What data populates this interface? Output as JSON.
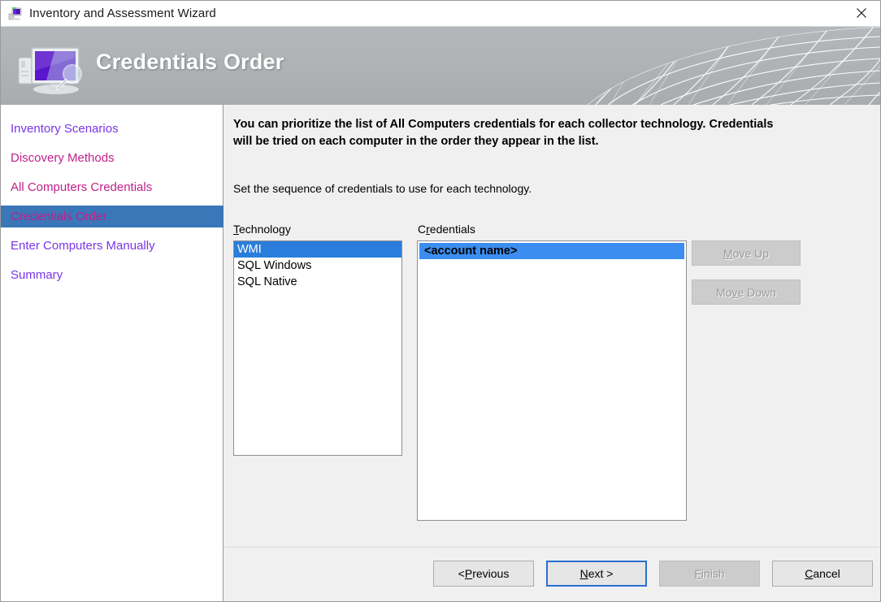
{
  "window": {
    "title": "Inventory and Assessment Wizard",
    "title_icon": "wizard-computer-icon",
    "close_icon": "close-icon"
  },
  "banner": {
    "title": "Credentials Order",
    "icon": "computer-magnifier-icon",
    "background_color": "#b0b3b6",
    "title_color": "#ffffff"
  },
  "sidebar": {
    "items": [
      {
        "label": "Inventory Scenarios",
        "state": "unvisited"
      },
      {
        "label": "Discovery Methods",
        "state": "visited"
      },
      {
        "label": "All Computers Credentials",
        "state": "visited"
      },
      {
        "label": "Credentials Order",
        "state": "current"
      },
      {
        "label": "Enter Computers Manually",
        "state": "unvisited"
      },
      {
        "label": "Summary",
        "state": "unvisited"
      }
    ],
    "current_highlight_color": "#3a76b8",
    "visited_color": "#c0208a",
    "unvisited_color": "#7a35e8"
  },
  "main": {
    "intro_bold": "You can prioritize the list of All Computers credentials for each collector technology. Credentials will be tried on each computer in the order they appear in the list.",
    "intro_normal": "Set the sequence of credentials to use for each technology.",
    "technology": {
      "label_accel": "T",
      "label_rest": "echnology",
      "options": [
        "WMI",
        "SQL Windows",
        "SQL Native"
      ],
      "selected": "WMI",
      "selection_color": "#2b7ddb"
    },
    "credentials": {
      "label_pre": "C",
      "label_accel": "r",
      "label_rest": "edentials",
      "options": [
        "<account name>"
      ],
      "selected": "<account name>",
      "selection_color": "#3b8ef0"
    },
    "move_up": {
      "accel": "M",
      "rest": "ove Up",
      "enabled": false
    },
    "move_down": {
      "pre": "Mo",
      "accel": "v",
      "rest": "e Down",
      "enabled": false
    }
  },
  "footer": {
    "previous": {
      "pre": "< ",
      "accel": "P",
      "rest": "revious",
      "enabled": true,
      "focused": false
    },
    "next": {
      "accel": "N",
      "rest": "ext >",
      "enabled": true,
      "focused": true
    },
    "finish": {
      "accel": "F",
      "rest": "inish",
      "enabled": false,
      "focused": false
    },
    "cancel": {
      "accel": "C",
      "rest": "ancel",
      "enabled": true,
      "focused": false
    }
  }
}
